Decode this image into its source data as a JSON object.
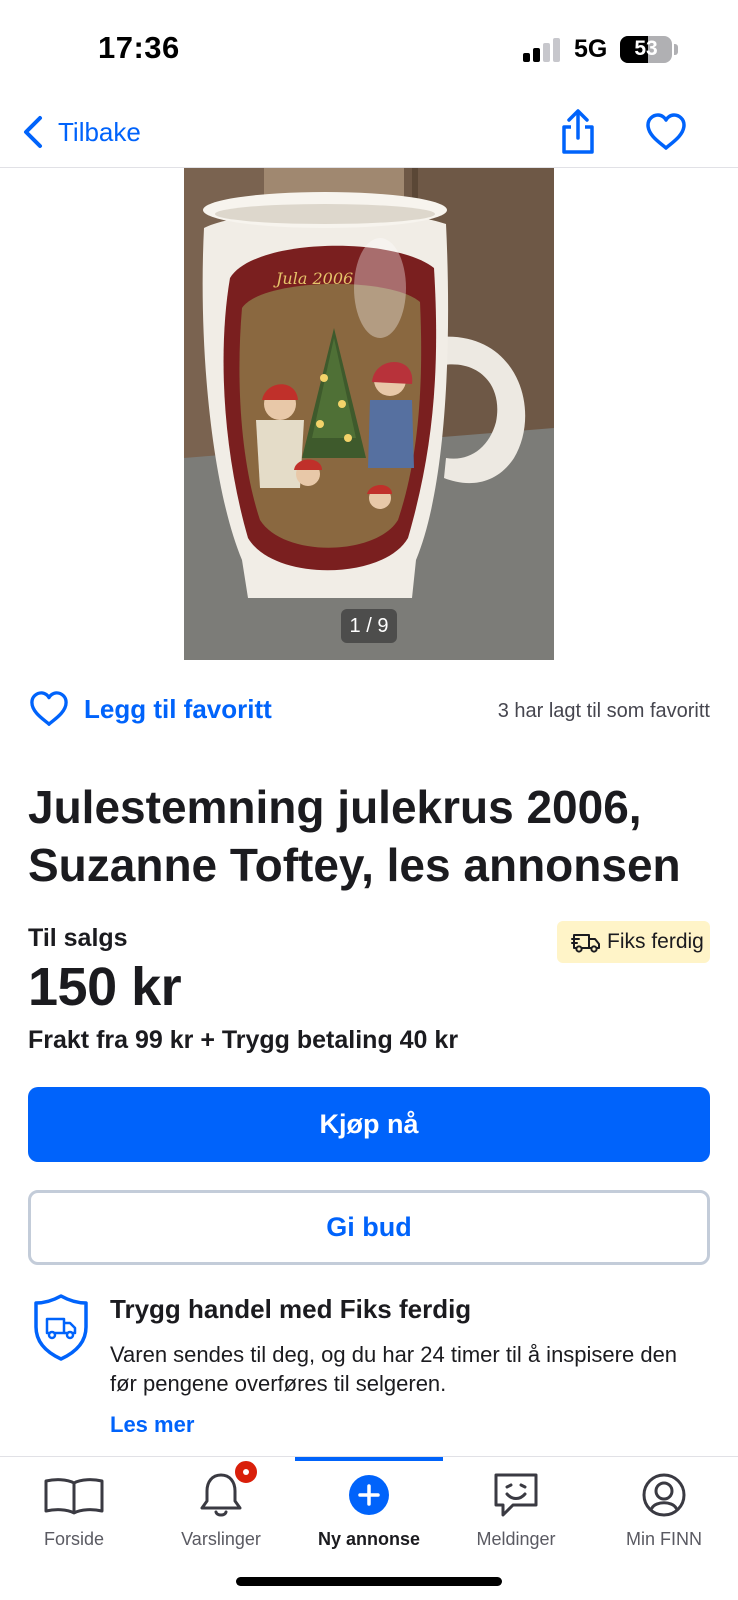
{
  "status_bar": {
    "time": "17:36",
    "network": "5G",
    "battery": "53",
    "battery_level": 0.53
  },
  "nav": {
    "back_label": "Tilbake",
    "share_icon": "share-icon",
    "favorite_icon": "heart-icon"
  },
  "gallery": {
    "counter": "1 / 9",
    "mug_text": "Jula 2006"
  },
  "favorite": {
    "label": "Legg til favoritt",
    "count_text": "3 har lagt til som favoritt"
  },
  "listing": {
    "title": "Julestemning julekrus 2006, Suzanne Toftey, les annonsen",
    "sale_label": "Til salgs",
    "badge": "Fiks ferdig",
    "price": "150 kr",
    "shipping": "Frakt fra 99 kr + Trygg betaling 40 kr"
  },
  "actions": {
    "buy": "Kjøp nå",
    "bid": "Gi bud"
  },
  "safe_trade": {
    "title": "Trygg handel med Fiks ferdig",
    "text": "Varen sendes til deg, og du har 24 timer til å inspisere den før pengene overføres til selgeren.",
    "link": "Les mer"
  },
  "tabs": [
    {
      "label": "Forside",
      "icon": "book-icon"
    },
    {
      "label": "Varslinger",
      "icon": "bell-icon"
    },
    {
      "label": "Ny annonse",
      "icon": "plus-circle-icon",
      "active": true
    },
    {
      "label": "Meldinger",
      "icon": "chat-icon"
    },
    {
      "label": "Min FINN",
      "icon": "profile-icon"
    }
  ],
  "colors": {
    "accent": "#0063fb",
    "badge_bg": "#fff4c8",
    "notification": "#d91f0a"
  }
}
